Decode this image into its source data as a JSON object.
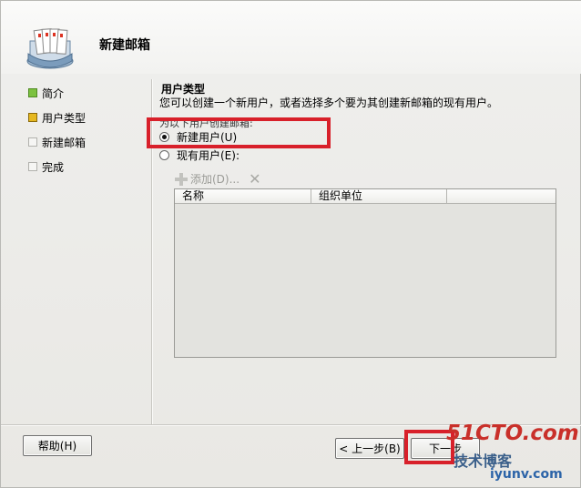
{
  "header": {
    "title": "新建邮箱"
  },
  "nav": {
    "items": [
      {
        "label": "简介",
        "state": "completed"
      },
      {
        "label": "用户类型",
        "state": "current"
      },
      {
        "label": "新建邮箱",
        "state": "pending"
      },
      {
        "label": "完成",
        "state": "pending"
      }
    ]
  },
  "content": {
    "section_title": "用户类型",
    "description": "您可以创建一个新用户，或者选择多个要为其创建新邮箱的现有用户。",
    "sub_description": "为以下用户创建邮箱:",
    "options": [
      {
        "label": "新建用户(U)",
        "checked": true
      },
      {
        "label": "现有用户(E):",
        "checked": false
      }
    ],
    "toolbar": {
      "add_label": "添加(D)...",
      "add_icon": "plus-icon",
      "remove_icon": "x-icon"
    },
    "grid": {
      "columns": [
        "名称",
        "组织单位"
      ],
      "rows": []
    }
  },
  "footer": {
    "help_label": "帮助(H)",
    "back_label": "< 上一步(B)",
    "next_label": "下一步"
  },
  "watermark": {
    "line1": "51CTO.com",
    "line2": "技术博客",
    "line3": "iyunv.com"
  },
  "colors": {
    "highlight": "#d8202a",
    "current_step": "#e6b820",
    "done_step": "#7cc23f"
  }
}
